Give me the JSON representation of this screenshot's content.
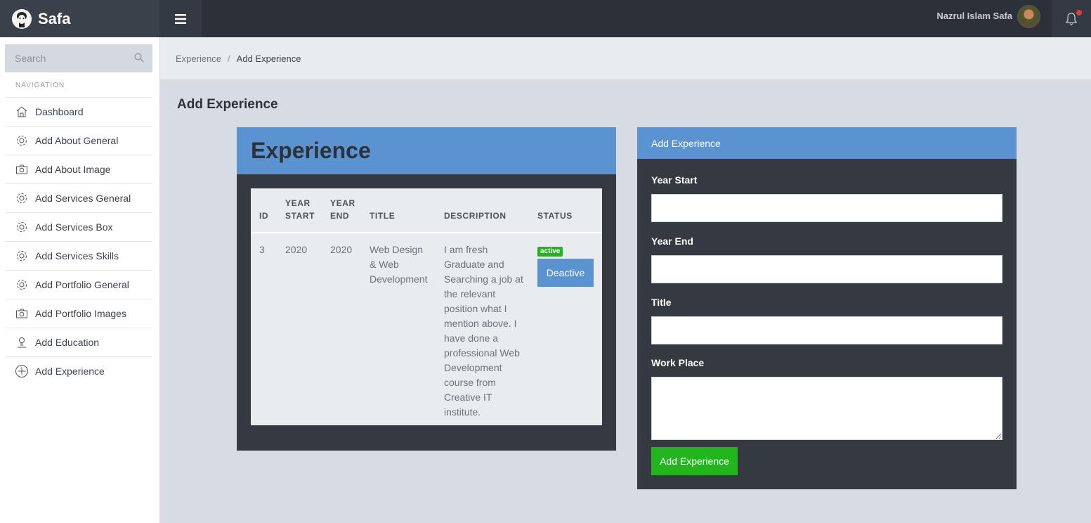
{
  "brand": {
    "name": "Safa"
  },
  "topbar": {
    "user_name": "Nazrul Islam Safa"
  },
  "sidebar": {
    "search_placeholder": "Search",
    "nav_heading": "NAVIGATION",
    "items": [
      {
        "label": "Dashboard",
        "icon": "home-icon"
      },
      {
        "label": "Add About General",
        "icon": "gear-icon"
      },
      {
        "label": "Add About Image",
        "icon": "camera-icon"
      },
      {
        "label": "Add Services General",
        "icon": "gear-icon"
      },
      {
        "label": "Add Services Box",
        "icon": "gear-icon"
      },
      {
        "label": "Add Services Skills",
        "icon": "gear-icon"
      },
      {
        "label": "Add Portfolio General",
        "icon": "gear-icon"
      },
      {
        "label": "Add Portfolio Images",
        "icon": "camera-icon"
      },
      {
        "label": "Add Education",
        "icon": "user-icon"
      },
      {
        "label": "Add Experience",
        "icon": "plus-circle-icon"
      }
    ]
  },
  "breadcrumb": {
    "parent": "Experience",
    "separator": "/",
    "current": "Add Experience"
  },
  "page": {
    "title": "Add Experience"
  },
  "experience_card": {
    "title": "Experience",
    "columns": [
      "ID",
      "YEAR START",
      "YEAR END",
      "TITLE",
      "DESCRIPTION",
      "STATUS"
    ],
    "rows": [
      {
        "id": "3",
        "year_start": "2020",
        "year_end": "2020",
        "title": "Web Design & Web Development",
        "description": "I am fresh Graduate and Searching a job at the relevant position what I mention above. I have done a professional Web Development course from Creative IT institute.",
        "status": "active",
        "action": "Deactive"
      }
    ]
  },
  "form_card": {
    "title": "Add Experience",
    "fields": {
      "year_start": "Year Start",
      "year_end": "Year End",
      "title": "Title",
      "work_place": "Work Place"
    },
    "submit_label": "Add Experience"
  },
  "colors": {
    "topbar": "#2c3038",
    "accent_blue": "#5b93d1",
    "success_green": "#23b51e",
    "card_dark": "#343a40",
    "notification": "#e23b3b"
  }
}
